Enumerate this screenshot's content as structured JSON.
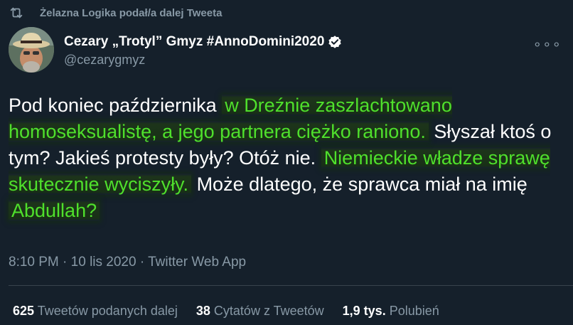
{
  "retweet": {
    "text": "Żelazna Logika podał/a dalej Tweeta",
    "icon": "retweet-icon"
  },
  "author": {
    "display_name": "Cezary „Trotyl” Gmyz #AnnoDomini2020",
    "handle": "@cezarygmyz",
    "verified_icon": "verified-badge-icon",
    "avatar": "avatar"
  },
  "more_label": "∘∘∘",
  "tweet": {
    "segments": [
      {
        "text": "Pod koniec października ",
        "highlight": false
      },
      {
        "text": "w Dreźnie zaszlachtowano homoseksualistę, a jego partnera ciężko raniono.",
        "highlight": true
      },
      {
        "text": " Słyszał ktoś o tym? Jakieś protesty były? Otóż nie. ",
        "highlight": false
      },
      {
        "text": "Niemieckie władze sprawę skutecznie wyciszyły.",
        "highlight": true
      },
      {
        "text": " Może dlatego, że sprawca miał na imię ",
        "highlight": false
      },
      {
        "text": "Abdullah?",
        "highlight": true
      }
    ]
  },
  "meta": {
    "time": "8:10 PM",
    "date": "10 lis 2020",
    "source": "Twitter Web App",
    "separator": " · "
  },
  "stats": {
    "retweets_count": "625",
    "retweets_label": "Tweetów podanych dalej",
    "quotes_count": "38",
    "quotes_label": "Cytatów z Tweetów",
    "likes_count": "1,9 tys.",
    "likes_label": "Polubień"
  },
  "colors": {
    "background": "#15202b",
    "secondary_text": "#8899a6",
    "highlight_text": "#4fe02c",
    "divider": "#38444d",
    "verified": "#ffffff"
  }
}
